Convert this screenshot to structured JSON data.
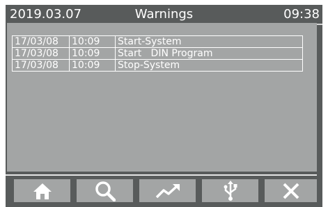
{
  "header": {
    "date": "2019.03.07",
    "title": "Warnings",
    "time": "09:38"
  },
  "warnings": [
    {
      "date": "17/03/08",
      "time": "10:09",
      "message": "Start-System"
    },
    {
      "date": "17/03/08",
      "time": "10:09",
      "message": "Start   DIN Program"
    },
    {
      "date": "17/03/08",
      "time": "10:09",
      "message": "Stop-System"
    }
  ],
  "toolbar": {
    "buttons": [
      {
        "icon": "home-icon"
      },
      {
        "icon": "search-icon"
      },
      {
        "icon": "trend-icon"
      },
      {
        "icon": "usb-icon"
      },
      {
        "icon": "close-icon"
      }
    ]
  },
  "colors": {
    "frame": "#585b5b",
    "panel": "#a3a5a5",
    "text": "#ffffff"
  }
}
